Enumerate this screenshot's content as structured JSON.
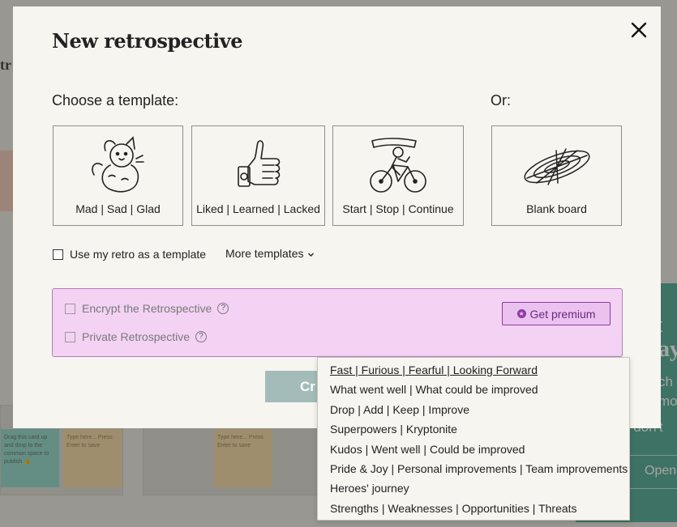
{
  "modal": {
    "title": "New retrospective",
    "choose_label": "Choose a template:",
    "or_label": "Or:",
    "templates": [
      {
        "label": "Mad | Sad | Glad",
        "icon": "cat-icon"
      },
      {
        "label": "Liked | Learned | Lacked",
        "icon": "thumbs-up-icon"
      },
      {
        "label": "Start | Stop | Continue",
        "icon": "cyclist-icon"
      }
    ],
    "blank": {
      "label": "Blank board",
      "icon": "disc-icon"
    },
    "use_my_retro": "Use my retro as a template",
    "more_templates": "More templates",
    "premium": {
      "encrypt": "Encrypt the Retrospective",
      "private": "Private Retrospective",
      "get_premium": "Get premium"
    },
    "create_label": "Cr"
  },
  "dropdown": {
    "items": [
      "Fast | Furious | Fearful | Looking Forward",
      "What went well | What could be improved",
      "Drop | Add | Keep | Improve",
      "Superpowers | Kryptonite",
      "Kudos | Went well | Could be improved",
      "Pride & Joy | Personal improvements | Team improvements",
      "Heroes' journey",
      "Strengths | Weaknesses | Opportunities | Threats"
    ]
  },
  "background": {
    "partial_title": "tr",
    "sticky_1": "Drag this card up and drop to the common space to publish 👍",
    "sticky_2": "Type here... Press Enter to save",
    "sticky_3": "Type here... Press Enter to save",
    "panel_letter_1": "t",
    "panel_letter_2": "ay",
    "panel_text_1": "ch",
    "panel_text_2": "mo",
    "panel_text_3": "y don't",
    "panel_button": "Open"
  },
  "colors": {
    "premium_bg": "#f3d2f4",
    "premium_accent": "#8b3da0",
    "create_btn": "#a3bcba",
    "panel": "#4fa793"
  }
}
